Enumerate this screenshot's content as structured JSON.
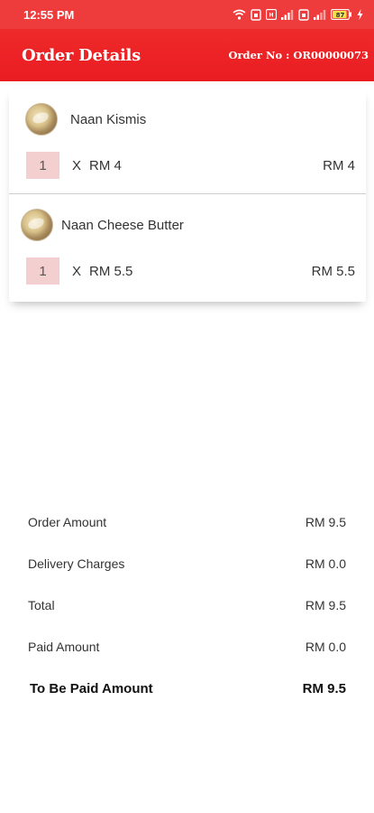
{
  "status_bar": {
    "time": "12:55 PM",
    "battery": "87",
    "icons": [
      "wifi-icon",
      "sim-icon",
      "volte-icon",
      "signal-icon",
      "sim2-icon",
      "signal2-icon",
      "battery-icon",
      "charging-icon"
    ]
  },
  "header": {
    "title": "Order Details",
    "order_no": "Order No : OR00000073"
  },
  "items": [
    {
      "name": "Naan Kismis",
      "qty": "1",
      "multiplier": "X",
      "unit_price": "RM 4",
      "line_total": "RM 4",
      "icon": "naan-thumbnail-icon"
    },
    {
      "name": "Naan Cheese Butter",
      "qty": "1",
      "multiplier": "X",
      "unit_price": "RM 5.5",
      "line_total": "RM 5.5",
      "icon": "naan-thumbnail-icon"
    }
  ],
  "summary": {
    "order_amount_label": "Order Amount",
    "order_amount_value": "RM 9.5",
    "delivery_label": "Delivery Charges",
    "delivery_value": "RM 0.0",
    "total_label": "Total",
    "total_value": "RM 9.5",
    "paid_label": "Paid Amount",
    "paid_value": "RM 0.0",
    "to_be_paid_label": "To Be Paid Amount",
    "to_be_paid_value": "RM 9.5"
  },
  "colors": {
    "accent": "#ee2a2a",
    "qty_box": "#f3cfcf"
  }
}
